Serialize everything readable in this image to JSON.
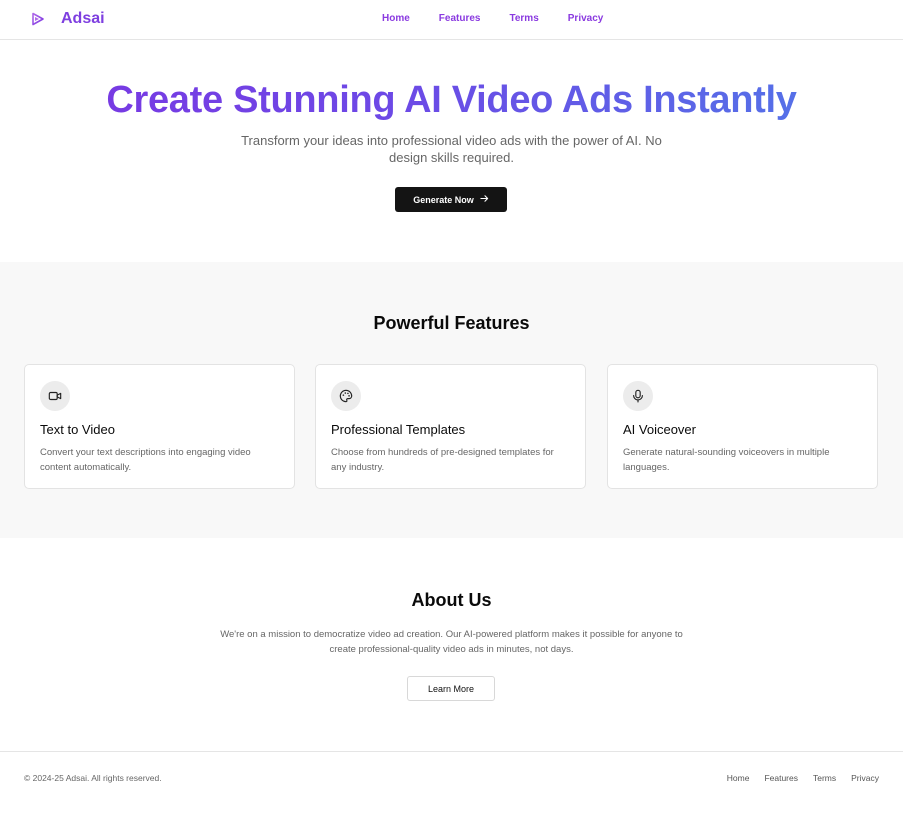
{
  "colors": {
    "brand": "#7e3fe0",
    "nav_link": "#8a3ae0",
    "gradient_start": "#7b35e2",
    "gradient_end": "#4f7ae8",
    "primary_button_bg": "#141414",
    "features_bg": "#f8f8f8"
  },
  "header": {
    "brand_icon": "play-triangle-icon",
    "brand_name": "Adsai",
    "nav": [
      "Home",
      "Features",
      "Terms",
      "Privacy"
    ]
  },
  "hero": {
    "title": "Create Stunning AI Video Ads Instantly",
    "subtitle": "Transform your ideas into professional video ads with the power of AI. No design skills required.",
    "cta_label": "Generate Now",
    "cta_icon": "arrow-right-icon"
  },
  "features": {
    "title": "Powerful Features",
    "cards": [
      {
        "icon": "video-camera-icon",
        "title": "Text to Video",
        "description": "Convert your text descriptions into engaging video content automatically."
      },
      {
        "icon": "palette-icon",
        "title": "Professional Templates",
        "description": "Choose from hundreds of pre-designed templates for any industry."
      },
      {
        "icon": "microphone-icon",
        "title": "AI Voiceover",
        "description": "Generate natural-sounding voiceovers in multiple languages."
      }
    ]
  },
  "about": {
    "title": "About Us",
    "text": "We're on a mission to democratize video ad creation. Our AI-powered platform makes it possible for anyone to create professional-quality video ads in minutes, not days.",
    "button_label": "Learn More"
  },
  "footer": {
    "copyright": "© 2024-25 Adsai. All rights reserved.",
    "links": [
      "Home",
      "Features",
      "Terms",
      "Privacy"
    ]
  }
}
